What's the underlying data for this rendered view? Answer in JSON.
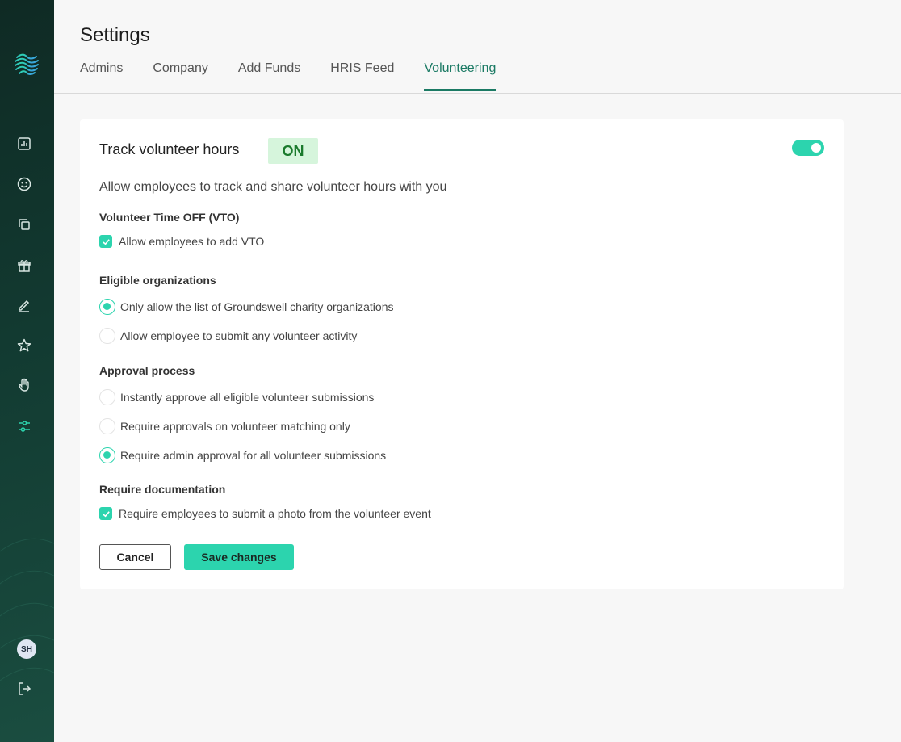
{
  "header": {
    "title": "Settings",
    "tabs": [
      {
        "label": "Admins"
      },
      {
        "label": "Company"
      },
      {
        "label": "Add Funds"
      },
      {
        "label": "HRIS Feed"
      },
      {
        "label": "Volunteering"
      }
    ],
    "active_tab": "Volunteering"
  },
  "sidebar": {
    "items": [
      {
        "icon": "bar-chart-icon"
      },
      {
        "icon": "smiley-icon"
      },
      {
        "icon": "copy-icon"
      },
      {
        "icon": "gift-icon"
      },
      {
        "icon": "pencil-icon"
      },
      {
        "icon": "star-icon"
      },
      {
        "icon": "hand-icon"
      },
      {
        "icon": "sliders-icon",
        "active": true
      }
    ],
    "avatar_initials": "SH",
    "logout_icon": "logout-icon"
  },
  "card": {
    "title": "Track volunteer hours",
    "status_badge": "ON",
    "toggle_on": true,
    "subtitle": "Allow employees to track and share volunteer hours with you",
    "vto": {
      "label": "Volunteer Time OFF (VTO)",
      "option": "Allow employees to add VTO",
      "checked": true
    },
    "eligible": {
      "label": "Eligible organizations",
      "options": [
        {
          "label": "Only allow the list of Groundswell charity organizations",
          "selected": true
        },
        {
          "label": "Allow employee to submit any volunteer activity",
          "selected": false
        }
      ]
    },
    "approval": {
      "label": "Approval process",
      "options": [
        {
          "label": "Instantly approve all eligible volunteer submissions",
          "selected": false
        },
        {
          "label": "Require approvals on volunteer matching only",
          "selected": false
        },
        {
          "label": "Require admin approval for all volunteer submissions",
          "selected": true
        }
      ]
    },
    "documentation": {
      "label": "Require documentation",
      "option": "Require employees to submit a photo from the volunteer event",
      "checked": true
    },
    "buttons": {
      "cancel": "Cancel",
      "save": "Save changes"
    }
  },
  "colors": {
    "accent": "#2cd4ae",
    "active_tab": "#1b7a64",
    "sidebar_bg": "#123a31",
    "badge_bg": "#d6f5dc",
    "badge_text": "#1a7a2c"
  }
}
